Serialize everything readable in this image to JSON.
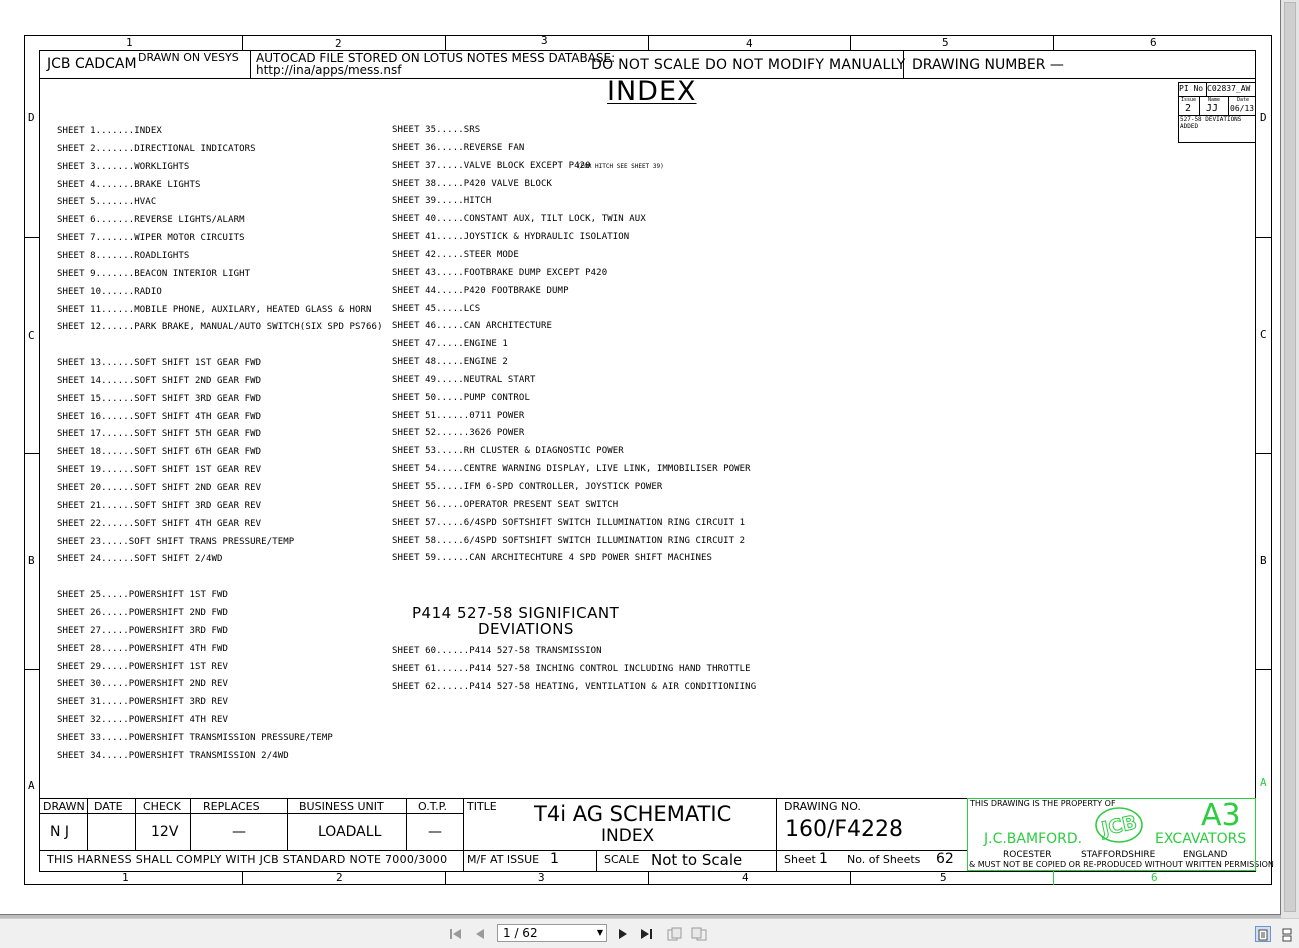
{
  "zones": {
    "columns": [
      "1",
      "2",
      "3",
      "4",
      "5",
      "6"
    ],
    "rows": [
      "D",
      "C",
      "B",
      "A"
    ]
  },
  "header": {
    "company": "JCB CADCAM",
    "drawn_on": "DRAWN ON VESYS",
    "autocad_line1": "AUTOCAD FILE STORED ON LOTUS NOTES MESS DATABASE:",
    "autocad_line2": "http://ina/apps/mess.nsf",
    "do_not_scale": "DO NOT SCALE DO NOT MODIFY MANUALLY",
    "drawing_number": "DRAWING NUMBER —"
  },
  "index_title": "INDEX",
  "revision": {
    "pi_label": "PI No",
    "pi_value": "C02837_AW",
    "issue_label": "Issue",
    "name_label": "Name",
    "date_label": "Date",
    "issue": "2",
    "name": "JJ",
    "date": "06/13",
    "note_line1": "527-58 DEVIATIONS",
    "note_line2": "ADDED"
  },
  "left_sheets": [
    "SHEET 1.......INDEX",
    "SHEET 2.......DIRECTIONAL INDICATORS",
    "SHEET 3.......WORKLIGHTS",
    "SHEET 4.......BRAKE LIGHTS",
    "SHEET 5.......HVAC",
    "SHEET 6.......REVERSE LIGHTS/ALARM",
    "SHEET 7.......WIPER MOTOR CIRCUITS",
    "SHEET 8.......ROADLIGHTS",
    "SHEET 9.......BEACON INTERIOR LIGHT",
    "SHEET 10......RADIO",
    "SHEET 11......MOBILE PHONE, AUXILARY, HEATED GLASS & HORN",
    "SHEET 12......PARK BRAKE, MANUAL/AUTO SWITCH(SIX SPD PS766)",
    "",
    "SHEET 13......SOFT SHIFT 1ST GEAR FWD",
    "SHEET 14......SOFT SHIFT 2ND GEAR FWD",
    "SHEET 15......SOFT SHIFT 3RD GEAR FWD",
    "SHEET 16......SOFT SHIFT 4TH GEAR FWD",
    "SHEET 17......SOFT SHIFT 5TH GEAR FWD",
    "SHEET 18......SOFT SHIFT 6TH GEAR FWD",
    "SHEET 19......SOFT SHIFT 1ST GEAR REV",
    "SHEET 20......SOFT SHIFT 2ND GEAR REV",
    "SHEET 21......SOFT SHIFT 3RD GEAR REV",
    "SHEET 22......SOFT SHIFT 4TH GEAR REV",
    "SHEET 23.....SOFT SHIFT TRANS PRESSURE/TEMP",
    "SHEET 24......SOFT SHIFT 2/4WD",
    "",
    "SHEET 25.....POWERSHIFT 1ST FWD",
    "SHEET 26.....POWERSHIFT 2ND FWD",
    "SHEET 27.....POWERSHIFT 3RD FWD",
    "SHEET 28.....POWERSHIFT 4TH FWD",
    "SHEET 29.....POWERSHIFT 1ST REV",
    "SHEET 30.....POWERSHIFT 2ND REV",
    "SHEET 31.....POWERSHIFT 3RD REV",
    "SHEET 32.....POWERSHIFT 4TH REV",
    "SHEET 33.....POWERSHIFT TRANSMISSION PRESSURE/TEMP",
    "SHEET 34.....POWERSHIFT TRANSMISSION 2/4WD"
  ],
  "right_sheets": [
    "SHEET 35.....SRS",
    "SHEET 36.....REVERSE FAN",
    "SHEET 37.....VALVE BLOCK EXCEPT P420",
    "SHEET 38.....P420 VALVE BLOCK",
    "SHEET 39.....HITCH",
    "SHEET 40.....CONSTANT AUX, TILT LOCK, TWIN AUX",
    "SHEET 41.....JOYSTICK & HYDRAULIC ISOLATION",
    "SHEET 42.....STEER MODE",
    "SHEET 43.....FOOTBRAKE DUMP EXCEPT P420",
    "SHEET 44.....P420 FOOTBRAKE DUMP",
    "SHEET 45.....LCS",
    "SHEET 46.....CAN ARCHITECTURE",
    "SHEET 47.....ENGINE 1",
    "SHEET 48.....ENGINE 2",
    "SHEET 49.....NEUTRAL START",
    "SHEET 50.....PUMP CONTROL",
    "SHEET 51......0711 POWER",
    "SHEET 52......3626 POWER",
    "SHEET 53.....RH CLUSTER & DIAGNOSTIC POWER",
    "SHEET 54.....CENTRE WARNING DISPLAY, LIVE LINK, IMMOBILISER POWER",
    "SHEET 55.....IFM 6-SPD CONTROLLER, JOYSTICK POWER",
    "SHEET 56.....OPERATOR PRESENT SEAT SWITCH",
    "SHEET 57.....6/4SPD SOFTSHIFT SWITCH ILLUMINATION RING CIRCUIT 1",
    "SHEET 58.....6/4SPD SOFTSHIFT SWITCH ILLUMINATION RING CIRCUIT 2",
    "SHEET 59......CAN ARCHITECHTURE 4 SPD POWER SHIFT MACHINES"
  ],
  "sheet37_note": "(FOR HITCH SEE SHEET 39)",
  "deviations_title_line1": "P414 527-58 SIGNIFICANT",
  "deviations_title_line2": "DEVIATIONS",
  "deviation_sheets": [
    "SHEET 60......P414 527-58 TRANSMISSION",
    "SHEET 61......P414 527-58 INCHING CONTROL INCLUDING HAND THROTTLE",
    "SHEET 62......P414 527-58 HEATING, VENTILATION & AIR CONDITIONIING"
  ],
  "title_block": {
    "drawn_label": "DRAWN",
    "date_label": "DATE",
    "check_label": "CHECK",
    "replaces_label": "REPLACES",
    "business_unit_label": "BUSINESS UNIT",
    "otp_label": "O.T.P.",
    "title_label": "TITLE",
    "drawing_no_label": "DRAWING NO.",
    "drawn_value": "N J",
    "date_value": "",
    "check_value": "12V",
    "replaces_value": "—",
    "business_unit_value": "LOADALL",
    "otp_value": "—",
    "title_line1": "T4i AG SCHEMATIC",
    "title_line2": "INDEX",
    "drawing_no_value": "160/F4228",
    "harness_note": "THIS HARNESS SHALL COMPLY WITH JCB STANDARD NOTE 7000/3000",
    "mf_label": "M/F AT ISSUE",
    "mf_value": "1",
    "scale_label": "SCALE",
    "scale_value": "Not to Scale",
    "sheet_label": "Sheet",
    "sheet_value": "1",
    "num_sheets_label": "No. of Sheets",
    "num_sheets_value": "62",
    "property_note": "THIS DRAWING IS THE PROPERTY OF",
    "company_name": "J.C.BAMFORD.",
    "logo_text": "JCB",
    "size": "A3",
    "division": "EXCAVATORS",
    "town": "ROCESTER",
    "county": "STAFFORDSHIRE",
    "country": "ENGLAND",
    "copy_note": "& MUST NOT BE COPIED OR RE-PRODUCED WITHOUT WRITTEN PERMISSION",
    "accent_green": "#2ecc40"
  },
  "viewer": {
    "page_indicator": "1 / 62",
    "first_icon": "first-page-icon",
    "prev_icon": "previous-page-icon",
    "next_icon": "next-page-icon",
    "last_icon": "last-page-icon"
  }
}
